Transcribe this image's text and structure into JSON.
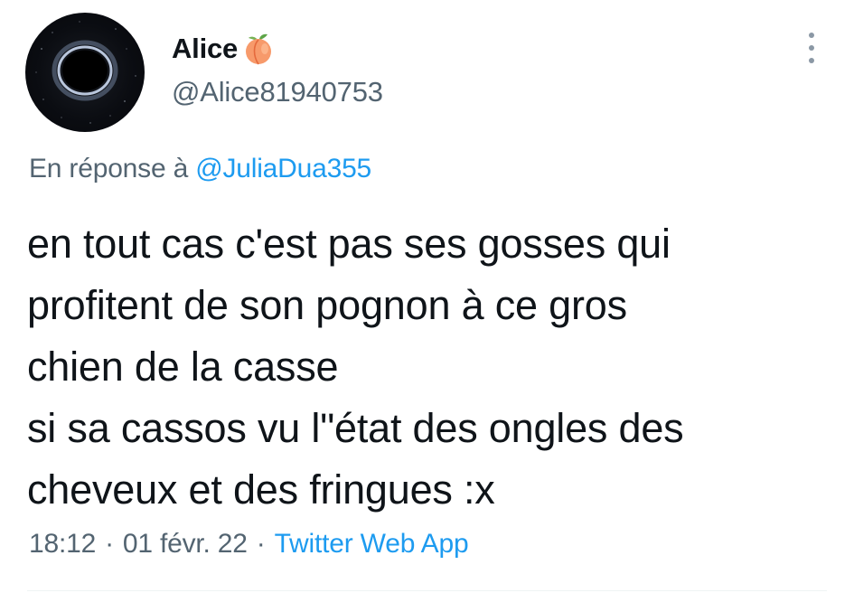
{
  "author": {
    "display_name": "Alice",
    "handle": "@Alice81940753",
    "avatar": "black-hole-avatar",
    "name_emoji": "peach-emoji"
  },
  "more_options": {
    "icon": "more-vertical-icon"
  },
  "reply": {
    "prefix": "En réponse à",
    "mention": "@JuliaDua355"
  },
  "text_lines": [
    "en tout cas c'est pas ses gosses qui",
    "profitent de son pognon à ce gros",
    "chien de la casse",
    "si sa cassos vu l\"état des ongles des",
    "cheveux et des fringues :x"
  ],
  "meta": {
    "time": "18:12",
    "separator": "·",
    "date": "01 févr. 22",
    "source": "Twitter Web App"
  },
  "colors": {
    "text": "#0f1419",
    "secondary": "#536471",
    "link": "#1d9bf0"
  }
}
